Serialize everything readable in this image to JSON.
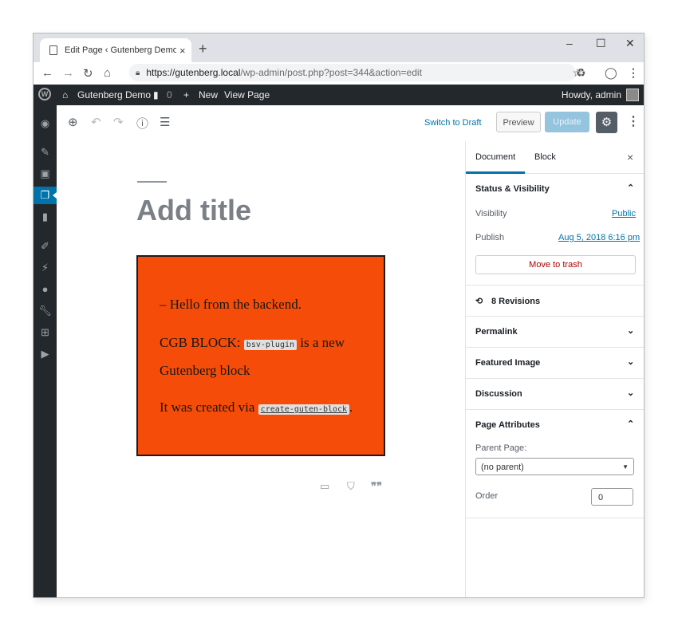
{
  "browser": {
    "tab_title": "Edit Page ‹ Gutenberg Demo — \\",
    "tab_close": "×",
    "new_tab": "+",
    "url_main": "https://gutenberg.local",
    "url_path": "/wp-admin/post.php?post=344&action=edit",
    "min": "–",
    "max": "☐",
    "close": "✕"
  },
  "adminbar": {
    "site_name": "Gutenberg Demo",
    "comments_count": "0",
    "new_label": "New",
    "view_page": "View Page",
    "howdy": "Howdy, admin"
  },
  "editor_header": {
    "switch_to_draft": "Switch to Draft",
    "preview": "Preview",
    "update": "Update"
  },
  "canvas": {
    "title_placeholder": "Add title",
    "block": {
      "line1": "– Hello from the backend.",
      "line2_pre": "CGB BLOCK: ",
      "line2_code": "bsv-plugin",
      "line2_post": " is a new Gutenberg block",
      "line3_pre": "It was created via ",
      "line3_code": "create-guten-block",
      "line3_post": "."
    }
  },
  "sidebar": {
    "tab_document": "Document",
    "tab_block": "Block",
    "close": "×",
    "status_visibility": "Status & Visibility",
    "visibility_label": "Visibility",
    "visibility_value": "Public",
    "publish_label": "Publish",
    "publish_value": "Aug 5, 2018 6:16 pm",
    "move_to_trash": "Move to trash",
    "revisions": "8 Revisions",
    "permalink": "Permalink",
    "featured_image": "Featured Image",
    "discussion": "Discussion",
    "page_attributes": "Page Attributes",
    "parent_page_label": "Parent Page:",
    "parent_page_value": "(no parent)",
    "order_label": "Order",
    "order_value": "0"
  },
  "colors": {
    "block_bg": "#f64c09",
    "admin_bar": "#23282d",
    "accent": "#0073aa"
  }
}
